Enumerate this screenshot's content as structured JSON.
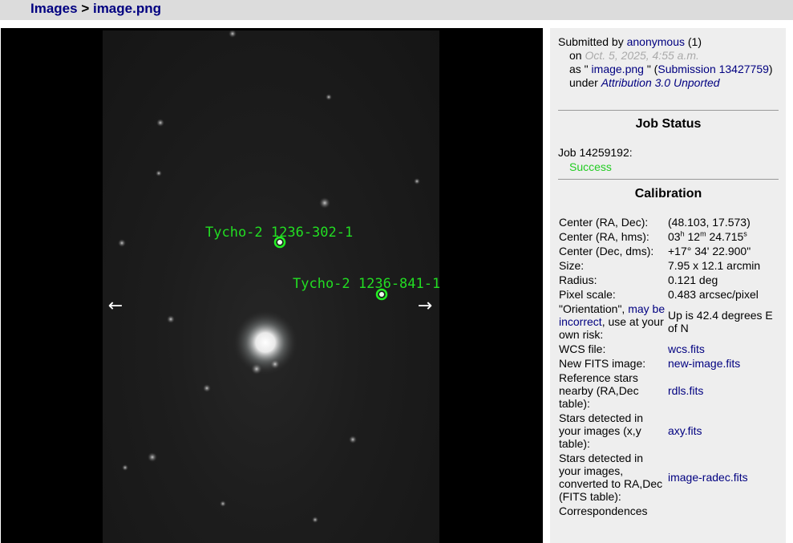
{
  "breadcrumb": {
    "images_link": "Images",
    "separator": " > ",
    "current": "image.png"
  },
  "viewer": {
    "left_arrow": "←",
    "right_arrow": "→",
    "stars": [
      {
        "label": "Tycho-2 1236-302-1"
      },
      {
        "label": "Tycho-2 1236-841-1"
      }
    ]
  },
  "submission": {
    "submitted_by_prefix": "Submitted by ",
    "user": "anonymous",
    "user_count": " (1)",
    "on_prefix": "on ",
    "date": "Oct. 5, 2025, 4:55 a.m.",
    "as_prefix": "as \" ",
    "filename": "image.png",
    "as_mid": " \" (",
    "submission_link": "Submission 13427759",
    "as_suffix": ")",
    "under_prefix": "under ",
    "license": "Attribution 3.0 Unported"
  },
  "job_status": {
    "heading": "Job Status",
    "job_label": "Job 14259192:",
    "status": "Success",
    "status_color": "#22cc22"
  },
  "calibration": {
    "heading": "Calibration",
    "center_radec_label": "Center (RA, Dec):",
    "center_radec_value": "(48.103, 17.573)",
    "center_hms_label": "Center (RA, hms):",
    "hms_h": "03",
    "hms_m": " 12",
    "hms_s": " 24.715",
    "center_dms_label": "Center (Dec, dms):",
    "center_dms_value": "+17° 34' 22.900\"",
    "size_label": "Size:",
    "size_value": "7.95 x 12.1 arcmin",
    "radius_label": "Radius:",
    "radius_value": "0.121 deg",
    "pixel_scale_label": "Pixel scale:",
    "pixel_scale_value": "0.483 arcsec/pixel",
    "orientation_pre": "\"Orientation\", ",
    "orientation_link": "may be incorrect",
    "orientation_post": ", use at your own risk:",
    "orientation_value": "Up is 42.4 degrees E of N",
    "wcs_label": "WCS file:",
    "wcs_link": "wcs.fits",
    "new_fits_label": "New FITS image:",
    "new_fits_link": "new-image.fits",
    "ref_stars_label": "Reference stars nearby (RA,Dec table):",
    "ref_stars_link": "rdls.fits",
    "detected_label": "Stars detected in your images (x,y table):",
    "detected_link": "axy.fits",
    "converted_label": "Stars detected in your images, converted to RA,Dec (FITS table):",
    "converted_link": "image-radec.fits",
    "correspondences_label": "Correspondences"
  }
}
